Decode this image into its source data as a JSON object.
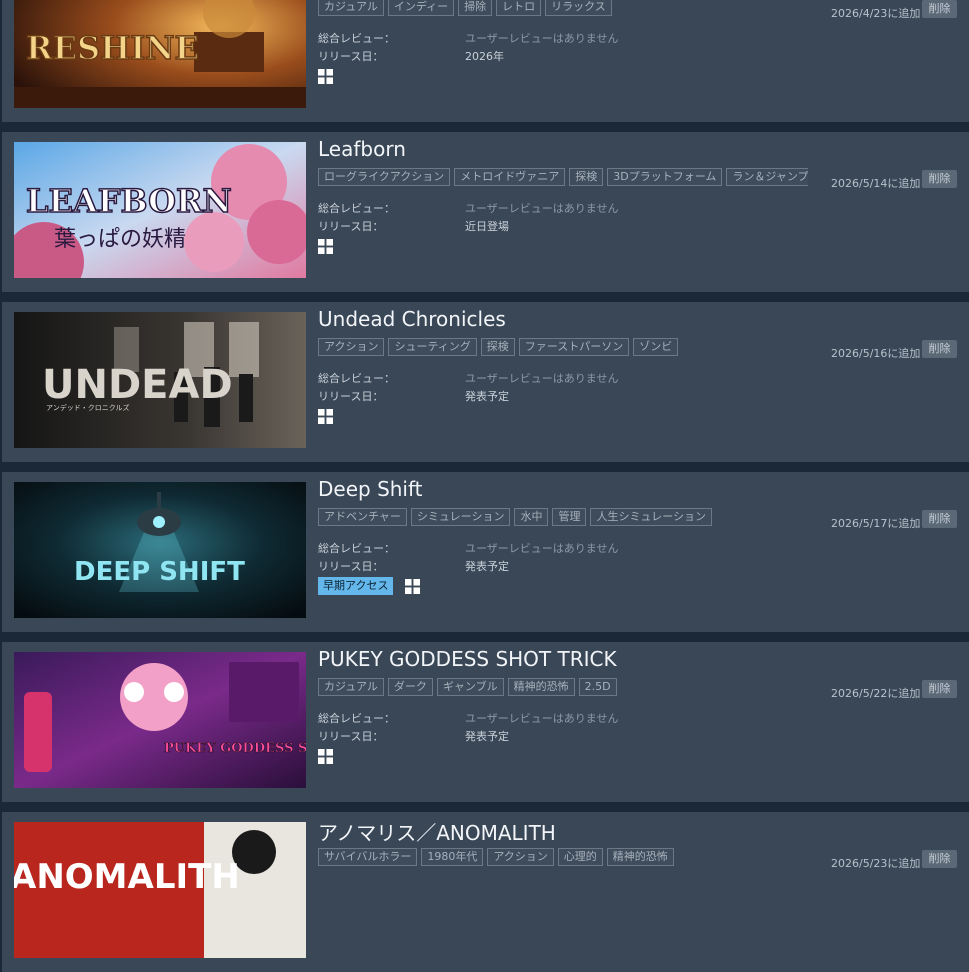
{
  "labels": {
    "review_label": "総合レビュー：",
    "release_label": "リリース日：",
    "remove_label": "削除"
  },
  "items": [
    {
      "title": "",
      "capsule_text": "RESHINE",
      "capsule_subtext": "",
      "tags": [
        "カジュアル",
        "インディー",
        "掃除",
        "レトロ",
        "リラックス"
      ],
      "review": "ユーザーレビューはありません",
      "release": "2026年",
      "early_access": "",
      "added": "2026/4/23に追加",
      "platform": "windows-icon"
    },
    {
      "title": "Leafborn",
      "capsule_text": "LEAFBORN",
      "capsule_subtext": "葉っぱの妖精",
      "tags": [
        "ローグライクアクション",
        "メトロイドヴァニア",
        "探検",
        "3Dプラットフォーム",
        "ラン＆ジャンプ"
      ],
      "review": "ユーザーレビューはありません",
      "release": "近日登場",
      "early_access": "",
      "added": "2026/5/14に追加",
      "platform": "windows-icon"
    },
    {
      "title": "Undead Chronicles",
      "capsule_text": "UNDEAD",
      "capsule_subtext": "アンデッド・クロニクルズ",
      "tags": [
        "アクション",
        "シューティング",
        "探検",
        "ファーストパーソン",
        "ゾンビ"
      ],
      "review": "ユーザーレビューはありません",
      "release": "発表予定",
      "early_access": "",
      "added": "2026/5/16に追加",
      "platform": "windows-icon"
    },
    {
      "title": "Deep Shift",
      "capsule_text": "DEEP SHIFT",
      "capsule_subtext": "",
      "tags": [
        "アドベンチャー",
        "シミュレーション",
        "水中",
        "管理",
        "人生シミュレーション"
      ],
      "review": "ユーザーレビューはありません",
      "release": "発表予定",
      "early_access": "早期アクセス",
      "added": "2026/5/17に追加",
      "platform": "windows-icon"
    },
    {
      "title": "PUKEY GODDESS SHOT TRICK",
      "capsule_text": "PUKEY GODDESS SHOT TRICK",
      "capsule_subtext": "",
      "tags": [
        "カジュアル",
        "ダーク",
        "ギャンブル",
        "精神的恐怖",
        "2.5D"
      ],
      "review": "ユーザーレビューはありません",
      "release": "発表予定",
      "early_access": "",
      "added": "2026/5/22に追加",
      "platform": "windows-icon"
    },
    {
      "title": "アノマリス／ANOMALITH",
      "capsule_text": "ANOMALITH",
      "capsule_subtext": "",
      "tags": [
        "サバイバルホラー",
        "1980年代",
        "アクション",
        "心理的",
        "精神的恐怖"
      ],
      "review": "",
      "release": "",
      "early_access": "",
      "added": "2026/5/23に追加",
      "platform": ""
    }
  ],
  "colors": {
    "page_bg": "#1b2838",
    "row_bg": "#3a4757",
    "early_access": "#63b7ea",
    "remove_bg": "#5b6876"
  }
}
